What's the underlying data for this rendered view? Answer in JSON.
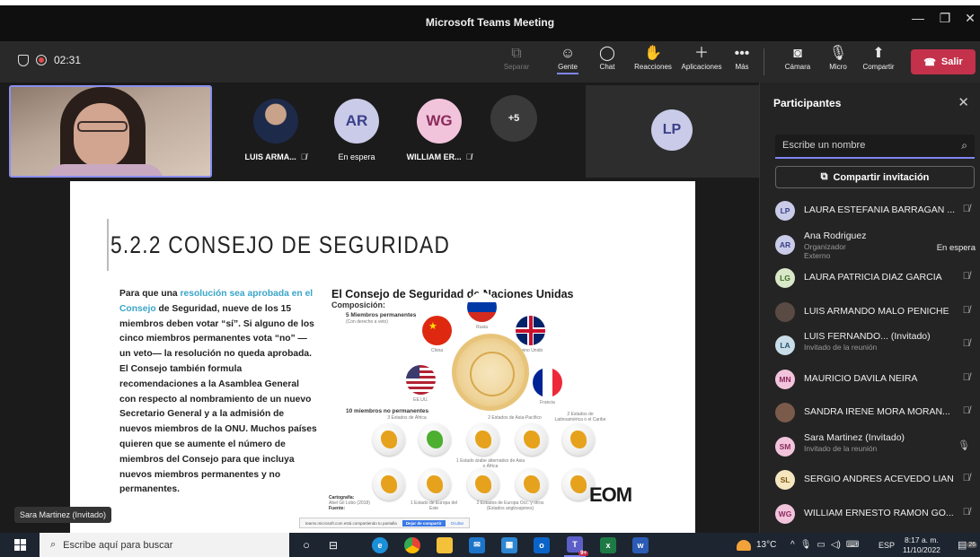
{
  "window": {
    "title": "Microsoft Teams Meeting",
    "min": "—",
    "max": "❐",
    "close": "✕"
  },
  "toolbar": {
    "timer": "02:31",
    "separar": "Separar",
    "gente": "Gente",
    "chat": "Chat",
    "reacciones": "Reacciones",
    "aplicaciones": "Aplicaciones",
    "mas": "Más",
    "camara": "Cámara",
    "micro": "Micro",
    "compartir": "Compartir",
    "salir": "Salir"
  },
  "tiles": {
    "p1": {
      "name": "LUIS ARMA..."
    },
    "p2": {
      "initials": "AR",
      "name": "En espera"
    },
    "p3": {
      "initials": "WG",
      "name": "WILLIAM ER..."
    },
    "more": "+5",
    "lp": "LP",
    "self_label": "Sara Martinez (Invitado)"
  },
  "slide": {
    "title": "5.2.2 CONSEJO DE SEGURIDAD",
    "body_pre": "Para que una ",
    "body_hl1": "resolución sea aprobada en el Consejo",
    "body_post": " de Seguridad, nueve de los 15 miembros deben votar “sí”. Si alguno de los cinco miembros permanentes vota “no” —un veto— la resolución no queda aprobada. El Consejo también formula recomendaciones a la Asamblea General con respecto al nombramiento de un nuevo Secretario General y a la admisión de nuevos miembros de la ONU. Muchos países quieren que se aumente el número de miembros del Consejo para que incluya nuevos miembros permanentes y no permanentes.",
    "infographic": {
      "title": "El Consejo de Seguridad de Naciones Unidas",
      "subtitle": "Composición:",
      "perm_label": "5 Miembros permanentes",
      "perm_sub": "(Con derecho a veto)",
      "countries": {
        "china": "China",
        "rusia": "Rusia",
        "uk": "Reino Unido",
        "usa": "EE.UU.",
        "francia": "Francia"
      },
      "nonperm_label": "10 miembros no permanentes",
      "africa3": "3 Estados de África",
      "asia2": "2 Estados de Asia-Pacífico",
      "latam2": "2 Estados de Latinoamérica o el Caribe",
      "arab1": "1 Estado árabe alternativo de Asia o África",
      "eeur1": "1 Estado de Europa del Este",
      "weur2": "2 Estados de Europa Occ. y otros (Estados anglosajones)",
      "carto": "Cartografía:",
      "carto_src": "Abel Gil Lobo (2018)",
      "fuente": "Fuente:",
      "brand": "EOM"
    },
    "share_bar": {
      "text": "teams.microsoft.com está compartiendo tu pantalla",
      "stop": "Dejar de compartir",
      "hide": "Ocultar"
    }
  },
  "panel": {
    "title": "Participantes",
    "search_placeholder": "Escribe un nombre",
    "invite": "Compartir invitación",
    "people": [
      {
        "initials": "LP",
        "name": "LAURA ESTEFANIA BARRAGAN ...",
        "color": "#c9cbe8",
        "fg": "#3a3f8a"
      },
      {
        "initials": "AR",
        "name": "Ana Rodriguez",
        "sub1": "Organizador",
        "sub2": "Externo",
        "status": "En espera",
        "color": "#c9cbe8",
        "fg": "#3a3f8a"
      },
      {
        "initials": "LG",
        "name": "LAURA PATRICIA DIAZ GARCIA",
        "color": "#d8e8c8",
        "fg": "#3f6b2a"
      },
      {
        "initials": "",
        "name": "LUIS ARMANDO MALO PENICHE",
        "color": "#5a4a44",
        "fg": "#fff"
      },
      {
        "initials": "LA",
        "name": "LUIS FERNANDO... (Invitado)",
        "sub1": "Invitado de la reunión",
        "color": "#c8dde8",
        "fg": "#2a5470"
      },
      {
        "initials": "MN",
        "name": "MAURICIO DAVILA NEIRA",
        "color": "#f2c4dc",
        "fg": "#8a2a5c"
      },
      {
        "initials": "",
        "name": "SANDRA IRENE MORA MORAN...",
        "color": "#7a5a4a",
        "fg": "#fff"
      },
      {
        "initials": "SM",
        "name": "Sara Martinez (Invitado)",
        "sub1": "Invitado de la reunión",
        "color": "#f2c4dc",
        "fg": "#8a2a5c"
      },
      {
        "initials": "SL",
        "name": "SERGIO ANDRES ACEVEDO LIAN",
        "color": "#f5e6c0",
        "fg": "#7a5a10"
      },
      {
        "initials": "WG",
        "name": "WILLIAM ERNESTO RAMON GO...",
        "color": "#f2c4dc",
        "fg": "#8a2a5c"
      }
    ]
  },
  "taskbar": {
    "search_placeholder": "Escribe aquí para buscar",
    "weather": "13°C",
    "lang": "ESP",
    "time": "8:17 a. m.",
    "date": "11/10/2022",
    "notif": "26",
    "teams_badge": "9+"
  }
}
